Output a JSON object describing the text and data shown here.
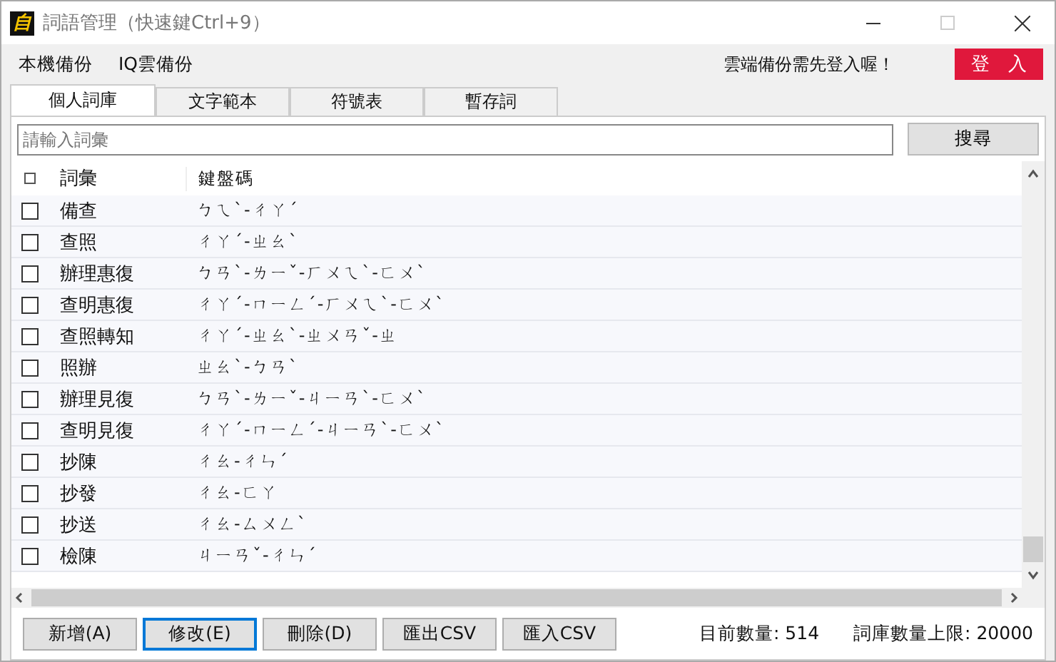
{
  "window": {
    "app_icon": "自",
    "title": "詞語管理（快速鍵Ctrl+9）"
  },
  "menu": [
    "本機備份",
    "IQ雲備份"
  ],
  "login_notice": "雲端備份需先登入喔！",
  "login_button": "登　入",
  "tabs": [
    {
      "label": "個人詞庫",
      "selected": true
    },
    {
      "label": "文字範本",
      "selected": false
    },
    {
      "label": "符號表",
      "selected": false
    },
    {
      "label": "暫存詞",
      "selected": false
    }
  ],
  "search": {
    "placeholder": "請輸入詞彙",
    "button": "搜尋"
  },
  "table": {
    "header_checked": false,
    "columns": [
      "詞彙",
      "鍵盤碼"
    ],
    "rows": [
      {
        "checked": false,
        "word": "備查",
        "code": "ㄅㄟˋ-ㄔㄚˊ"
      },
      {
        "checked": false,
        "word": "查照",
        "code": "ㄔㄚˊ-ㄓㄠˋ"
      },
      {
        "checked": false,
        "word": "辦理惠復",
        "code": "ㄅㄢˋ-ㄌㄧˇ-ㄏㄨㄟˋ-ㄈㄨˋ"
      },
      {
        "checked": false,
        "word": "查明惠復",
        "code": "ㄔㄚˊ-ㄇㄧㄥˊ-ㄏㄨㄟˋ-ㄈㄨˋ"
      },
      {
        "checked": false,
        "word": "查照轉知",
        "code": "ㄔㄚˊ-ㄓㄠˋ-ㄓㄨㄢˇ-ㄓ"
      },
      {
        "checked": false,
        "word": "照辦",
        "code": "ㄓㄠˋ-ㄅㄢˋ"
      },
      {
        "checked": false,
        "word": "辦理見復",
        "code": "ㄅㄢˋ-ㄌㄧˇ-ㄐㄧㄢˋ-ㄈㄨˋ"
      },
      {
        "checked": false,
        "word": "查明見復",
        "code": "ㄔㄚˊ-ㄇㄧㄥˊ-ㄐㄧㄢˋ-ㄈㄨˋ"
      },
      {
        "checked": false,
        "word": "抄陳",
        "code": "ㄔㄠ-ㄔㄣˊ"
      },
      {
        "checked": false,
        "word": "抄發",
        "code": "ㄔㄠ-ㄈㄚ"
      },
      {
        "checked": false,
        "word": "抄送",
        "code": "ㄔㄠ-ㄙㄨㄥˋ"
      },
      {
        "checked": false,
        "word": "檢陳",
        "code": "ㄐㄧㄢˇ-ㄔㄣˊ"
      }
    ]
  },
  "buttons": [
    {
      "label": "新增(A)",
      "focused": false
    },
    {
      "label": "修改(E)",
      "focused": true
    },
    {
      "label": "刪除(D)",
      "focused": false
    },
    {
      "label": "匯出CSV",
      "focused": false
    },
    {
      "label": "匯入CSV",
      "focused": false
    }
  ],
  "status": [
    "目前數量: 514",
    "詞庫數量上限: 20000"
  ]
}
